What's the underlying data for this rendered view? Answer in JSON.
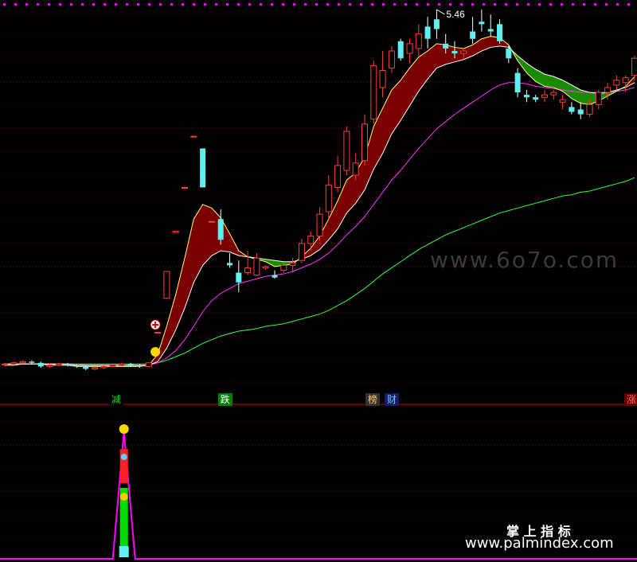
{
  "chart_data": {
    "type": "candlestick",
    "upper_panel": {
      "price_label": "5.46",
      "candles": [
        [
          2.55,
          2.56,
          2.53,
          2.55
        ],
        [
          2.55,
          2.57,
          2.54,
          2.56
        ],
        [
          2.56,
          2.58,
          2.55,
          2.57
        ],
        [
          2.57,
          2.58,
          2.55,
          2.56
        ],
        [
          2.56,
          2.57,
          2.52,
          2.53
        ],
        [
          2.53,
          2.55,
          2.52,
          2.54
        ],
        [
          2.54,
          2.56,
          2.53,
          2.55
        ],
        [
          2.55,
          2.56,
          2.53,
          2.54
        ],
        [
          2.54,
          2.55,
          2.52,
          2.53
        ],
        [
          2.53,
          2.54,
          2.5,
          2.51
        ],
        [
          2.51,
          2.53,
          2.5,
          2.52
        ],
        [
          2.52,
          2.54,
          2.51,
          2.53
        ],
        [
          2.53,
          2.55,
          2.52,
          2.54
        ],
        [
          2.54,
          2.56,
          2.53,
          2.55
        ],
        [
          2.55,
          2.56,
          2.53,
          2.54
        ],
        [
          2.54,
          2.55,
          2.52,
          2.53
        ],
        [
          2.53,
          2.56,
          2.53,
          2.56
        ],
        [
          2.81,
          2.81,
          2.81,
          2.81
        ],
        [
          3.09,
          3.31,
          3.09,
          3.31
        ],
        [
          3.63,
          3.64,
          3.63,
          3.64
        ],
        [
          4.0,
          4.0,
          4.0,
          4.0
        ],
        [
          4.42,
          4.42,
          4.42,
          4.42
        ],
        [
          4.32,
          4.32,
          4.0,
          4.0
        ],
        [
          3.72,
          3.72,
          3.72,
          3.72
        ],
        [
          3.74,
          3.82,
          3.53,
          3.57
        ],
        [
          3.38,
          3.46,
          3.34,
          3.36
        ],
        [
          3.3,
          3.4,
          3.14,
          3.22
        ],
        [
          3.3,
          3.48,
          3.28,
          3.34
        ],
        [
          3.28,
          3.46,
          3.27,
          3.42
        ],
        [
          3.34,
          3.36,
          3.32,
          3.35
        ],
        [
          3.28,
          3.32,
          3.25,
          3.26
        ],
        [
          3.32,
          3.38,
          3.3,
          3.36
        ],
        [
          3.36,
          3.42,
          3.3,
          3.38
        ],
        [
          3.4,
          3.58,
          3.38,
          3.54
        ],
        [
          3.54,
          3.64,
          3.48,
          3.6
        ],
        [
          3.6,
          3.84,
          3.56,
          3.78
        ],
        [
          3.8,
          4.1,
          3.74,
          4.02
        ],
        [
          4.0,
          4.26,
          3.96,
          4.18
        ],
        [
          4.14,
          4.5,
          4.1,
          4.46
        ],
        [
          4.1,
          4.28,
          4.06,
          4.2
        ],
        [
          4.22,
          4.6,
          4.18,
          4.52
        ],
        [
          4.56,
          5.04,
          4.52,
          5.0
        ],
        [
          4.82,
          5.12,
          4.74,
          4.96
        ],
        [
          4.98,
          5.16,
          4.94,
          5.12
        ],
        [
          5.2,
          5.22,
          5.04,
          5.06
        ],
        [
          5.1,
          5.22,
          5.02,
          5.18
        ],
        [
          5.14,
          5.34,
          5.08,
          5.26
        ],
        [
          5.32,
          5.4,
          5.14,
          5.22
        ],
        [
          5.38,
          5.46,
          5.22,
          5.3
        ],
        [
          5.18,
          5.26,
          5.1,
          5.14
        ],
        [
          5.12,
          5.2,
          5.06,
          5.1
        ],
        [
          5.1,
          5.14,
          5.06,
          5.12
        ],
        [
          5.28,
          5.4,
          5.18,
          5.22
        ],
        [
          5.36,
          5.46,
          5.28,
          5.34
        ],
        [
          5.3,
          5.42,
          5.24,
          5.28
        ],
        [
          5.34,
          5.38,
          5.18,
          5.2
        ],
        [
          5.14,
          5.16,
          5.02,
          5.06
        ],
        [
          4.94,
          4.98,
          4.74,
          4.78
        ],
        [
          4.76,
          4.8,
          4.7,
          4.74
        ],
        [
          4.74,
          4.76,
          4.7,
          4.72
        ],
        [
          4.74,
          4.8,
          4.7,
          4.76
        ],
        [
          4.76,
          4.8,
          4.72,
          4.78
        ],
        [
          4.7,
          4.76,
          4.64,
          4.72
        ],
        [
          4.66,
          4.7,
          4.6,
          4.62
        ],
        [
          4.64,
          4.7,
          4.56,
          4.6
        ],
        [
          4.6,
          4.72,
          4.58,
          4.68
        ],
        [
          4.68,
          4.8,
          4.64,
          4.78
        ],
        [
          4.78,
          4.86,
          4.72,
          4.82
        ],
        [
          4.84,
          4.92,
          4.8,
          4.88
        ],
        [
          4.86,
          4.92,
          4.78,
          4.9
        ],
        [
          4.92,
          5.08,
          4.88,
          5.06
        ]
      ],
      "ema_fast": [
        2.54,
        2.54,
        2.55,
        2.55,
        2.55,
        2.54,
        2.54,
        2.54,
        2.53,
        2.53,
        2.53,
        2.53,
        2.53,
        2.53,
        2.53,
        2.53,
        2.54,
        2.63,
        2.86,
        3.12,
        3.42,
        3.74,
        3.86,
        3.83,
        3.75,
        3.62,
        3.48,
        3.43,
        3.41,
        3.39,
        3.35,
        3.36,
        3.37,
        3.43,
        3.5,
        3.6,
        3.74,
        3.89,
        4.06,
        4.12,
        4.25,
        4.5,
        4.65,
        4.8,
        4.88,
        4.98,
        5.07,
        5.12,
        5.18,
        5.17,
        5.15,
        5.14,
        5.17,
        5.22,
        5.24,
        5.23,
        5.17,
        5.04,
        4.94,
        4.87,
        4.83,
        4.82,
        4.79,
        4.73,
        4.69,
        4.68,
        4.71,
        4.75,
        4.79,
        4.83,
        4.91
      ],
      "ema_slow": [
        2.55,
        2.55,
        2.55,
        2.55,
        2.55,
        2.55,
        2.55,
        2.55,
        2.54,
        2.54,
        2.54,
        2.54,
        2.54,
        2.54,
        2.54,
        2.54,
        2.54,
        2.57,
        2.68,
        2.83,
        3.01,
        3.22,
        3.36,
        3.44,
        3.48,
        3.47,
        3.44,
        3.43,
        3.42,
        3.41,
        3.4,
        3.39,
        3.39,
        3.41,
        3.44,
        3.49,
        3.57,
        3.66,
        3.79,
        3.87,
        3.98,
        4.15,
        4.28,
        4.44,
        4.55,
        4.67,
        4.79,
        4.89,
        4.98,
        5.01,
        5.03,
        5.05,
        5.08,
        5.12,
        5.15,
        5.16,
        5.15,
        5.08,
        5.02,
        4.97,
        4.93,
        4.91,
        4.88,
        4.84,
        4.8,
        4.78,
        4.77,
        4.78,
        4.8,
        4.82,
        4.86
      ],
      "ma_mid": [
        2.55,
        2.55,
        2.55,
        2.55,
        2.55,
        2.55,
        2.55,
        2.55,
        2.55,
        2.54,
        2.54,
        2.54,
        2.54,
        2.54,
        2.54,
        2.54,
        2.54,
        2.56,
        2.6,
        2.66,
        2.75,
        2.86,
        2.98,
        3.07,
        3.13,
        3.17,
        3.21,
        3.23,
        3.25,
        3.27,
        3.28,
        3.29,
        3.31,
        3.34,
        3.37,
        3.41,
        3.46,
        3.53,
        3.61,
        3.68,
        3.76,
        3.86,
        3.96,
        4.06,
        4.14,
        4.23,
        4.32,
        4.4,
        4.48,
        4.54,
        4.6,
        4.65,
        4.7,
        4.75,
        4.8,
        4.84,
        4.86,
        4.86,
        4.85,
        4.83,
        4.82,
        4.81,
        4.8,
        4.79,
        4.78,
        4.78,
        4.78,
        4.78,
        4.79,
        4.8,
        4.82
      ],
      "ma_long": [
        2.55,
        2.55,
        2.55,
        2.55,
        2.55,
        2.55,
        2.55,
        2.55,
        2.55,
        2.55,
        2.55,
        2.55,
        2.55,
        2.55,
        2.55,
        2.55,
        2.55,
        2.56,
        2.58,
        2.61,
        2.64,
        2.68,
        2.72,
        2.75,
        2.78,
        2.8,
        2.82,
        2.83,
        2.84,
        2.86,
        2.87,
        2.88,
        2.9,
        2.92,
        2.94,
        2.96,
        2.99,
        3.03,
        3.07,
        3.12,
        3.17,
        3.23,
        3.29,
        3.34,
        3.39,
        3.44,
        3.49,
        3.53,
        3.57,
        3.61,
        3.64,
        3.67,
        3.7,
        3.73,
        3.76,
        3.79,
        3.81,
        3.83,
        3.85,
        3.87,
        3.89,
        3.91,
        3.93,
        3.94,
        3.96,
        3.97,
        3.99,
        4.01,
        4.03,
        4.05,
        4.08
      ]
    },
    "signal_tags": [
      {
        "text": "减",
        "color": "#00e000",
        "bg": "#000000",
        "index": 17
      },
      {
        "text": "跌",
        "color": "#ffffff",
        "bg": "#008000",
        "index": 34
      },
      {
        "text": "榜",
        "color": "#ffcc66",
        "bg": "#333333",
        "index": 57
      },
      {
        "text": "财",
        "color": "#66ccff",
        "bg": "#1a1a66",
        "index": 60
      },
      {
        "text": "涨",
        "color": "#ff6666",
        "bg": "#660000",
        "index": 98
      }
    ],
    "lower_panel": {
      "spike_index": 19,
      "green_level": 0.55,
      "red_level": 0.85,
      "line_color": "#ff00ff"
    },
    "colors": {
      "up": "#ff3b3b",
      "down": "#5ef0f0",
      "ema_fast": "#ffff66",
      "ema_slow": "#ffffff",
      "ma_mid": "#ff33ff",
      "ma_long": "#33ff33",
      "band_up": "#7a0000",
      "band_down": "#1a8a00",
      "grid": "#7a0000"
    }
  },
  "watermark": {
    "site_small": "www.6o7o.com",
    "brand": "掌 上 指 标",
    "site": "www.palmindex.com"
  }
}
